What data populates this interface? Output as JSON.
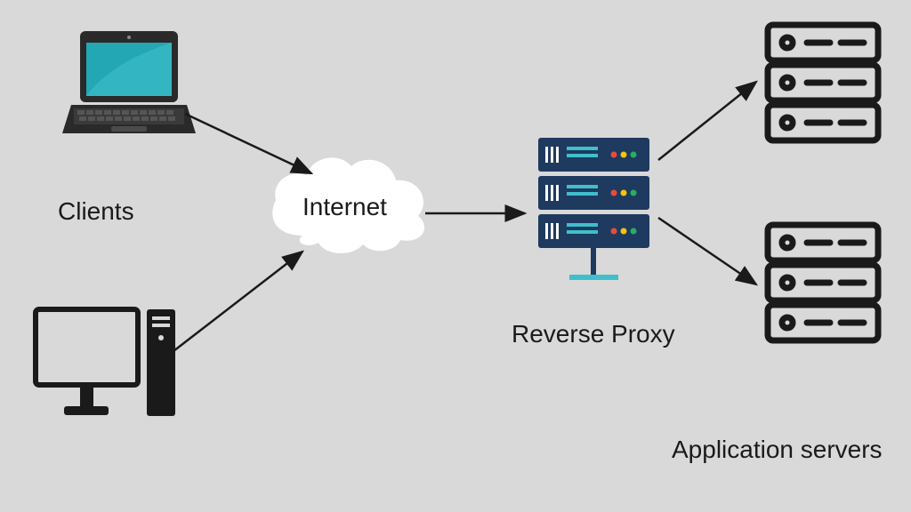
{
  "labels": {
    "clients": "Clients",
    "internet": "Internet",
    "reverse_proxy": "Reverse Proxy",
    "application_servers": "Application servers"
  },
  "nodes": {
    "laptop": "laptop-client",
    "desktop": "desktop-client",
    "cloud": "internet-cloud",
    "proxy": "reverse-proxy-server",
    "server1": "application-server-1",
    "server2": "application-server-2"
  },
  "flow": [
    {
      "from": "laptop",
      "to": "cloud"
    },
    {
      "from": "desktop",
      "to": "cloud"
    },
    {
      "from": "cloud",
      "to": "proxy"
    },
    {
      "from": "proxy",
      "to": "server1"
    },
    {
      "from": "proxy",
      "to": "server2"
    }
  ]
}
